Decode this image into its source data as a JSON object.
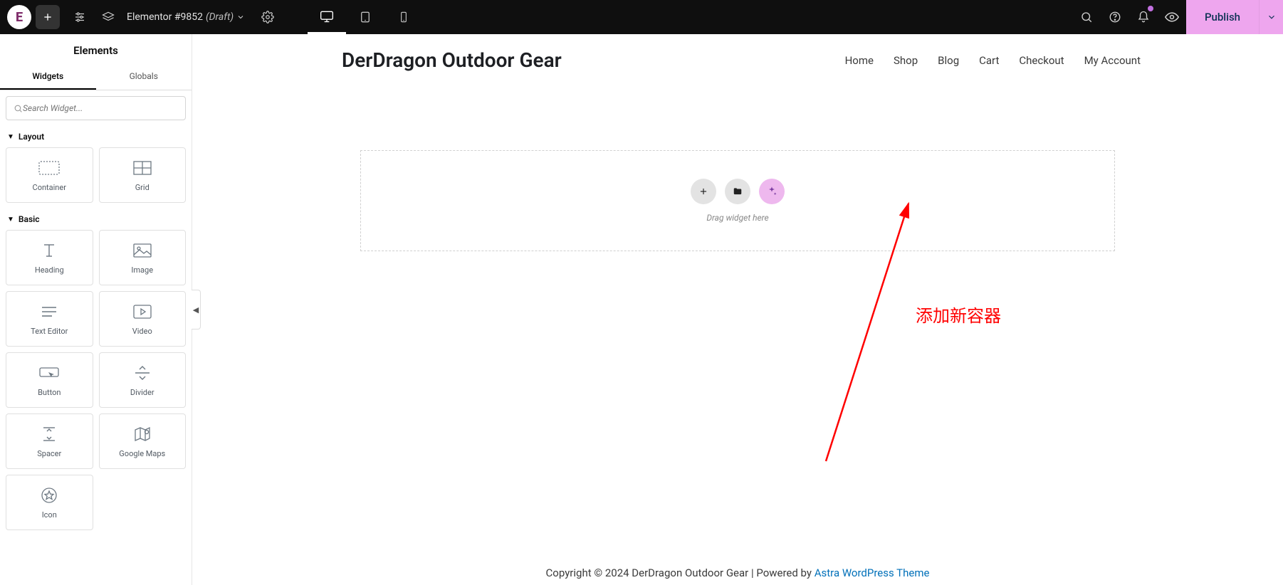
{
  "topbar": {
    "logo_letter": "E",
    "doc_title": "Elementor #9852",
    "doc_status": "(Draft)",
    "publish_label": "Publish"
  },
  "sidebar": {
    "title": "Elements",
    "tabs": {
      "widgets": "Widgets",
      "globals": "Globals"
    },
    "search_placeholder": "Search Widget...",
    "sections": {
      "layout": {
        "label": "Layout",
        "items": [
          {
            "name": "container",
            "label": "Container"
          },
          {
            "name": "grid",
            "label": "Grid"
          }
        ]
      },
      "basic": {
        "label": "Basic",
        "items": [
          {
            "name": "heading",
            "label": "Heading"
          },
          {
            "name": "image",
            "label": "Image"
          },
          {
            "name": "text-editor",
            "label": "Text Editor"
          },
          {
            "name": "video",
            "label": "Video"
          },
          {
            "name": "button",
            "label": "Button"
          },
          {
            "name": "divider",
            "label": "Divider"
          },
          {
            "name": "spacer",
            "label": "Spacer"
          },
          {
            "name": "google-maps",
            "label": "Google Maps"
          },
          {
            "name": "icon",
            "label": "Icon"
          }
        ]
      }
    }
  },
  "site": {
    "title": "DerDragon Outdoor Gear",
    "nav": [
      "Home",
      "Shop",
      "Blog",
      "Cart",
      "Checkout",
      "My Account"
    ]
  },
  "drop": {
    "hint": "Drag widget here"
  },
  "annotation": {
    "text": "添加新容器"
  },
  "footer": {
    "prefix": "Copyright © 2024 DerDragon Outdoor Gear | Powered by ",
    "link": "Astra WordPress Theme"
  }
}
